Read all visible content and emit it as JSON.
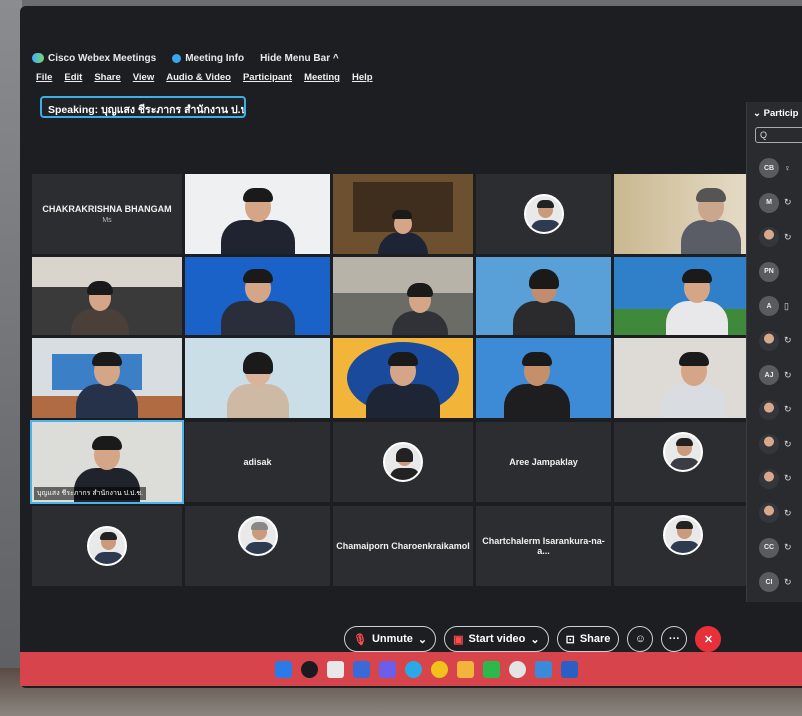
{
  "app": {
    "title": "Cisco Webex Meetings",
    "meeting_info": "Meeting Info",
    "hide_menu": "Hide Menu Bar ^"
  },
  "menu": [
    "File",
    "Edit",
    "Share",
    "View",
    "Audio & Video",
    "Participant",
    "Meeting",
    "Help"
  ],
  "speaking": "Speaking: บุญแสง ชีระภากร สำนักงาน ป.ป.ช.",
  "tiles": {
    "t1_name": "CHAKRAKRISHNA BHANGAM",
    "t1_sub": "Ms",
    "t16_label": "บุญแสง ชีระภากร สำนักงาน ป.ป.ช.",
    "t17_name": "adisak",
    "t19_name": "Aree Jampaklay",
    "t24_name": "Chamaiporn Charoenkraikamol",
    "t25_name": "Chartchalerm Isarankura-na-a..."
  },
  "sidebar": {
    "header": "Particip",
    "search_icon": "Q",
    "avatars": [
      "CB",
      "M",
      "",
      "PN",
      "A",
      "",
      "AJ",
      "",
      "",
      "",
      "",
      "CC",
      "CI"
    ]
  },
  "controls": {
    "unmute": "Unmute",
    "start_video": "Start video",
    "share": "Share"
  }
}
